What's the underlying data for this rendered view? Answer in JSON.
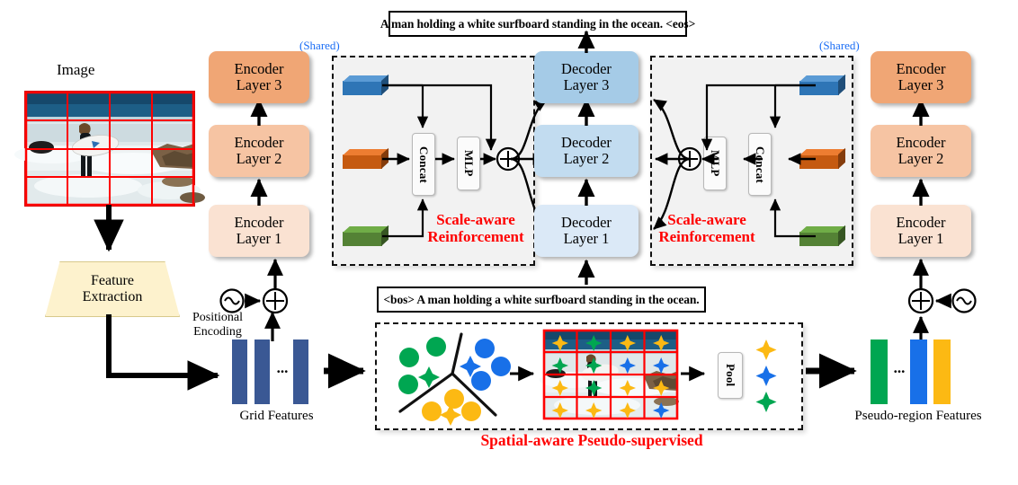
{
  "figure": {
    "type": "architecture-diagram",
    "title": "Scale-aware Reinforcement and Spatial-aware Pseudo-supervised image captioning architecture"
  },
  "captions": {
    "output_caption": "A man holding a white surfboard standing in the ocean. <eos>",
    "input_caption": "<bos> A man holding a white surfboard standing in the ocean."
  },
  "labels": {
    "image": "Image",
    "feature_extraction_line1": "Feature",
    "feature_extraction_line2": "Extraction",
    "positional_encoding_line1": "Positional",
    "positional_encoding_line2": "Encoding",
    "grid_features": "Grid Features",
    "pseudo_region_features": "Pseudo-region Features",
    "shared_left": "(Shared)",
    "shared_right": "(Shared)",
    "ellipsis": "..."
  },
  "encoder_left": {
    "layers": [
      {
        "line1": "Encoder",
        "line2": "Layer 1",
        "color": "#fae2d2"
      },
      {
        "line1": "Encoder",
        "line2": "Layer 2",
        "color": "#f6c4a3"
      },
      {
        "line1": "Encoder",
        "line2": "Layer 3",
        "color": "#f0a675"
      }
    ]
  },
  "encoder_right": {
    "layers": [
      {
        "line1": "Encoder",
        "line2": "Layer 1",
        "color": "#fae2d2"
      },
      {
        "line1": "Encoder",
        "line2": "Layer 2",
        "color": "#f6c4a3"
      },
      {
        "line1": "Encoder",
        "line2": "Layer 3",
        "color": "#f0a675"
      }
    ]
  },
  "decoder": {
    "layers": [
      {
        "line1": "Decoder",
        "line2": "Layer 1",
        "color": "#dbe9f7"
      },
      {
        "line1": "Decoder",
        "line2": "Layer 2",
        "color": "#c2dcf0"
      },
      {
        "line1": "Decoder",
        "line2": "Layer 3",
        "color": "#a5cbe7"
      }
    ]
  },
  "sar_left": {
    "title_line1": "Scale-aware",
    "title_line2": "Reinforcement",
    "concat_label": "Concat",
    "mlp_label": "MLP",
    "bars": [
      {
        "name": "blue-scale-bar",
        "color": "#2e75b6"
      },
      {
        "name": "orange-scale-bar",
        "color": "#c55a11"
      },
      {
        "name": "green-scale-bar",
        "color": "#548235"
      }
    ],
    "sum_symbol": "⊕"
  },
  "sar_right": {
    "title_line1": "Scale-aware",
    "title_line2": "Reinforcement",
    "concat_label": "Concat",
    "mlp_label": "MLP",
    "bars": [
      {
        "name": "blue-scale-bar",
        "color": "#2e75b6"
      },
      {
        "name": "orange-scale-bar",
        "color": "#c55a11"
      },
      {
        "name": "green-scale-bar",
        "color": "#548235"
      }
    ],
    "sum_symbol": "⊕"
  },
  "spatial_block": {
    "title": "Spatial-aware Pseudo-supervised",
    "pool_label": "Pool",
    "cluster_colors": {
      "green": "#00a651",
      "blue": "#1870e8",
      "yellow": "#fcb913"
    },
    "pool_output_stars": [
      "#fcb913",
      "#1870e8",
      "#00a651"
    ]
  },
  "grid_features_bars": {
    "color": "#3a5894",
    "count": 3,
    "ellipsis": "..."
  },
  "pseudo_region_bars": {
    "colors": [
      "#00a651",
      "#1870e8",
      "#fcb913"
    ],
    "ellipsis": "..."
  },
  "colors": {
    "grid_overlay": "#ff0000",
    "red_text": "#ff0000",
    "blue_text": "#1b6ef5",
    "arrow": "#000000",
    "panel_fill": "#f2f2f2"
  },
  "star_grid": {
    "rows": 4,
    "cols": 4,
    "colors": [
      [
        "#fcb913",
        "#00a651",
        "#fcb913",
        "#fcb913"
      ],
      [
        "#00a651",
        "#00a651",
        "#1870e8",
        "#1870e8"
      ],
      [
        "#fcb913",
        "#00a651",
        "#fcb913",
        "#fcb913"
      ],
      [
        "#fcb913",
        "#fcb913",
        "#fcb913",
        "#1870e8"
      ]
    ]
  }
}
